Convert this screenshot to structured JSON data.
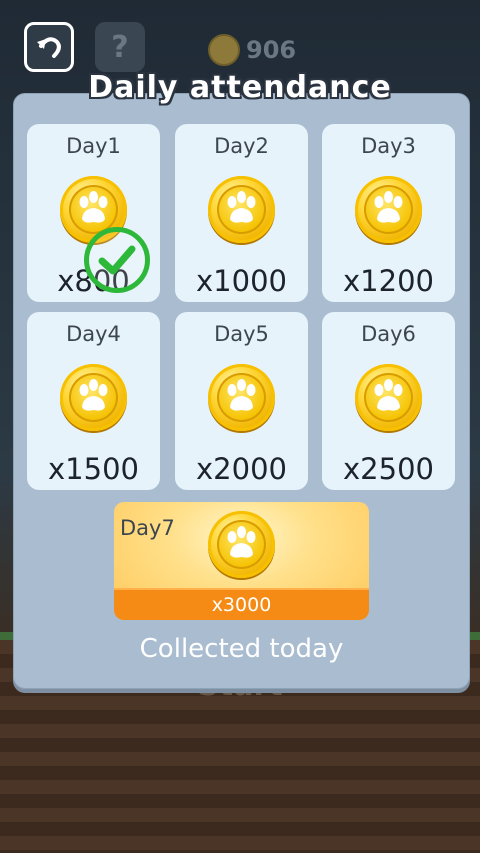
{
  "header": {
    "coin_count": "906"
  },
  "background": {
    "start_label": "Start"
  },
  "dialog": {
    "title": "Daily attendance",
    "days": [
      {
        "label": "Day1",
        "amount": "x800",
        "collected": true
      },
      {
        "label": "Day2",
        "amount": "x1000",
        "collected": false
      },
      {
        "label": "Day3",
        "amount": "x1200",
        "collected": false
      },
      {
        "label": "Day4",
        "amount": "x1500",
        "collected": false
      },
      {
        "label": "Day5",
        "amount": "x2000",
        "collected": false
      },
      {
        "label": "Day6",
        "amount": "x2500",
        "collected": false
      }
    ],
    "day7": {
      "label": "Day7",
      "amount": "x3000"
    },
    "status": "Collected today"
  },
  "icons": {
    "back": "back-arrow-icon",
    "help": "question-mark-icon",
    "coin": "paw-coin-icon",
    "check": "checkmark-icon"
  },
  "colors": {
    "panel": "#a9bcd0",
    "card": "#e6f3fb",
    "check": "#2eb83a",
    "day7_bar": "#f58a14"
  }
}
